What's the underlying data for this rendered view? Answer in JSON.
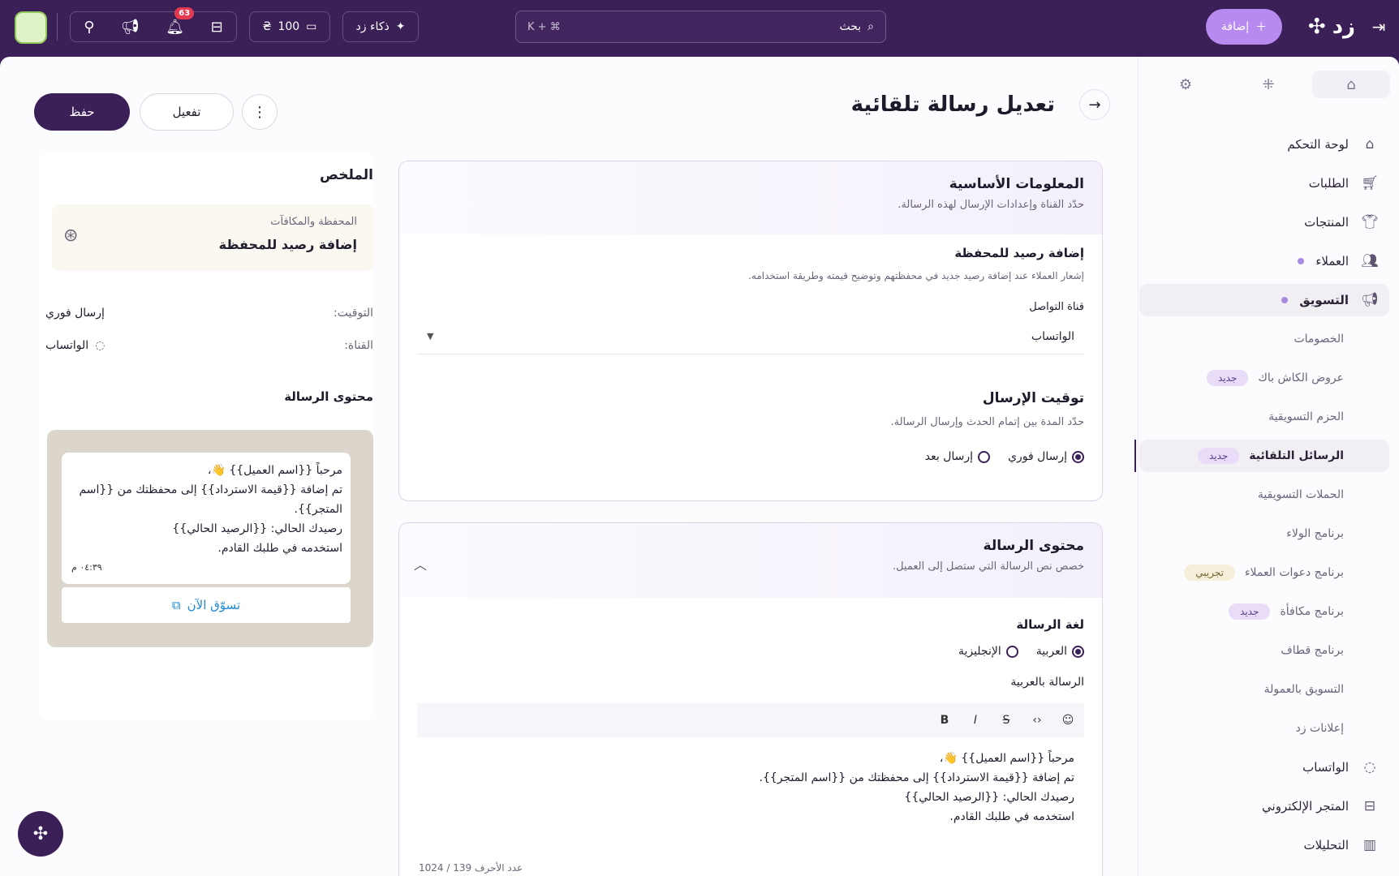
{
  "topbar": {
    "brand_name": "زد",
    "add_label": "إضافة",
    "search_placeholder": "بحث",
    "search_shortcut": "⌘ + K",
    "ai_label": "ذكاء زد",
    "points_value": "100",
    "currency_symbol": "₴",
    "notification_count": "63"
  },
  "sidebar": {
    "items": [
      {
        "label": "لوحة التحكم",
        "icon": "home-icon"
      },
      {
        "label": "الطلبات",
        "icon": "cart-icon"
      },
      {
        "label": "المنتجات",
        "icon": "shirt-icon"
      },
      {
        "label": "العملاء",
        "icon": "users-icon"
      },
      {
        "label": "التسويق",
        "icon": "megaphone-icon"
      }
    ],
    "marketing_sub": [
      {
        "label": "الخصومات",
        "badge": ""
      },
      {
        "label": "عروض الكاش باك",
        "badge": "جديد"
      },
      {
        "label": "الحزم التسويقية",
        "badge": ""
      },
      {
        "label": "الرسائل التلقائية",
        "badge": "جديد"
      },
      {
        "label": "الحملات التسويقية",
        "badge": ""
      },
      {
        "label": "برنامج الولاء",
        "badge": ""
      },
      {
        "label": "برنامج دعوات العملاء",
        "badge": "تجريبي"
      },
      {
        "label": "برنامج مكافأة",
        "badge": "جديد"
      },
      {
        "label": "برنامج قطاف",
        "badge": ""
      },
      {
        "label": "التسويق بالعمولة",
        "badge": ""
      },
      {
        "label": "إعلانات زد",
        "badge": ""
      }
    ],
    "bottom_items": [
      {
        "label": "الواتساب",
        "icon": "whatsapp-icon"
      },
      {
        "label": "المتجر الإلكتروني",
        "icon": "store-icon"
      },
      {
        "label": "التحليلات",
        "icon": "chart-icon"
      }
    ]
  },
  "page": {
    "title": "تعديل رسالة تلقائية",
    "save_label": "حفظ",
    "activate_label": "تفعيل"
  },
  "basic_info": {
    "title": "المعلومات الأساسية",
    "subtitle": "حدّد القناة وإعدادات الإرسال لهذه الرسالة.",
    "event_title": "إضافة رصيد للمحفظة",
    "event_desc": "إشعار العملاء عند إضافة رصيد جديد في محفظتهم وتوضيح قيمته وطريقة استخدامه.",
    "channel_label": "قناة التواصل",
    "channel_value": "الواتساب",
    "timing_title": "توقيت الإرسال",
    "timing_desc": "حدّد المدة بين إتمام الحدث وإرسال الرسالة.",
    "timing_instant": "إرسال فوري",
    "timing_later": "إرسال بعد"
  },
  "content": {
    "title": "محتوى الرسالة",
    "subtitle": "خصص نص الرسالة التي ستصل إلى العميل.",
    "lang_label": "لغة الرسالة",
    "lang_ar": "العربية",
    "lang_en": "الإنجليزية",
    "message_ar_label": "الرسالة بالعربية",
    "lines": [
      "مرحباً {{اسم العميل}} 👋،",
      "تم إضافة {{قيمة الاسترداد}} إلى محفظتك من {{اسم المتجر}}.",
      "رصيدك الحالي: {{الرصيد الحالي}}",
      "استخدمه في طلبك القادم."
    ],
    "char_count": "عدد الأحرف 139 / 1024"
  },
  "summary": {
    "title": "الملخص",
    "category": "المحفظة والمكافآت",
    "event": "إضافة رصيد للمحفظة",
    "timing_key": "التوقيت:",
    "timing_value": "إرسال فوري",
    "channel_key": "القناة:",
    "channel_value": "الواتساب",
    "content_title": "محتوى الرسالة",
    "preview_lines": [
      "مرحباً {{اسم العميل}} 👋،",
      "تم إضافة {{قيمة الاسترداد}} إلى محفظتك من {{اسم",
      "المتجر}}.",
      "رصيدك الحالي: {{الرصيد الحالي}}",
      "استخدمه في طلبك القادم."
    ],
    "preview_time": "٠٤:٣٩ م",
    "shop_now": "تسوّق الآن"
  }
}
